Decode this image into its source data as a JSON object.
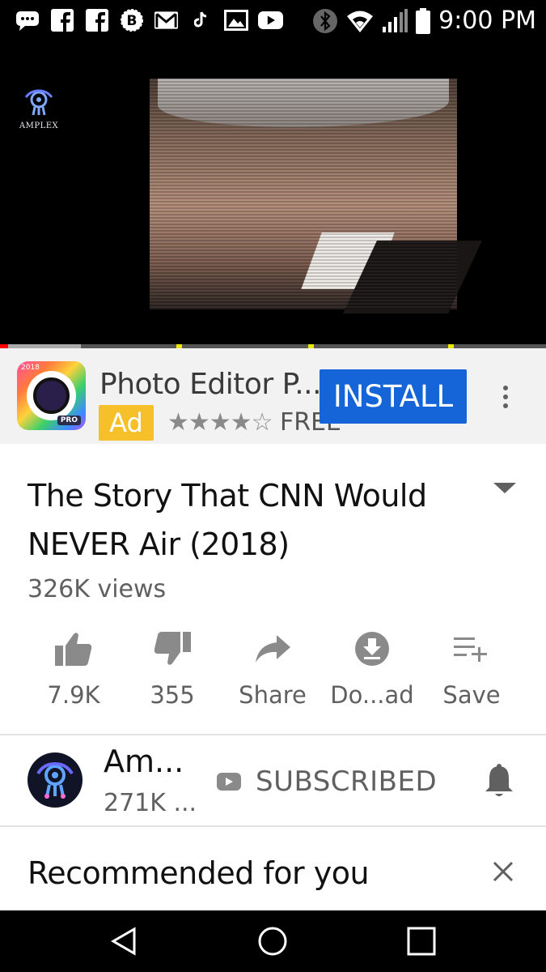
{
  "status_bar": {
    "time": "9:00 PM",
    "icons": [
      "messaging-icon",
      "facebook-icon",
      "facebook-icon",
      "bitcoin-icon",
      "gmail-icon",
      "tiktok-icon",
      "gallery-icon",
      "youtube-icon",
      "bluetooth-icon",
      "wifi-icon",
      "signal-icon",
      "battery-icon"
    ]
  },
  "player": {
    "watermark_text": "AMPLEX",
    "progress_fraction": 0.015,
    "accent_color": "#ff0000"
  },
  "ad": {
    "title": "Photo Editor P...",
    "badge": "Ad",
    "rating_stars": "★★★★☆",
    "rating_value": 4,
    "price": "FREE",
    "install_label": "INSTALL",
    "icon_year": "2018",
    "icon_pro": "PRO",
    "button_color": "#1565d8",
    "badge_color": "#f6c02b"
  },
  "video": {
    "title": "The Story That CNN Would NEVER Air (2018)",
    "views": "326K views"
  },
  "actions": [
    {
      "name": "like",
      "label": "7.9K",
      "icon": "thumbs-up-icon"
    },
    {
      "name": "dislike",
      "label": "355",
      "icon": "thumbs-down-icon"
    },
    {
      "name": "share",
      "label": "Share",
      "icon": "share-arrow-icon"
    },
    {
      "name": "download",
      "label": "Do...ad",
      "icon": "download-icon"
    },
    {
      "name": "save",
      "label": "Save",
      "icon": "playlist-add-icon"
    }
  ],
  "channel": {
    "name": "Am...",
    "subscribers": "271K ...",
    "subscribe_label": "SUBSCRIBED"
  },
  "recommended": {
    "title": "Recommended for you"
  }
}
